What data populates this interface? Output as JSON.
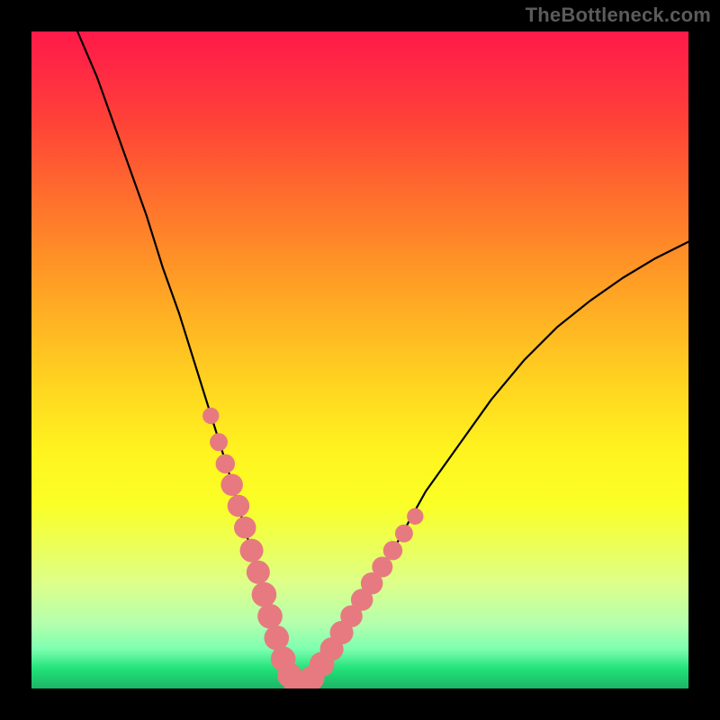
{
  "watermark": "TheBottleneck.com",
  "chart_data": {
    "type": "line",
    "title": "",
    "xlabel": "",
    "ylabel": "",
    "xlim": [
      0,
      100
    ],
    "ylim": [
      0,
      100
    ],
    "series": [
      {
        "name": "curve",
        "x": [
          7,
          10,
          12.5,
          15,
          17.5,
          20,
          22.5,
          25,
          27.5,
          30,
          32,
          34,
          35.5,
          37,
          38,
          39,
          40,
          41,
          43,
          46,
          50,
          55,
          60,
          65,
          70,
          75,
          80,
          85,
          90,
          95,
          100
        ],
        "y": [
          100,
          93,
          86,
          79,
          72,
          64,
          57,
          49,
          41,
          33,
          26,
          19,
          13,
          8,
          5,
          2,
          0.5,
          0.5,
          2,
          6,
          12,
          21,
          30,
          37,
          44,
          50,
          55,
          59,
          62.5,
          65.5,
          68
        ]
      }
    ],
    "markers": {
      "name": "left-dots",
      "color": "#e77a80",
      "points": [
        {
          "x": 27.3,
          "y": 41.5,
          "r": 1.2
        },
        {
          "x": 28.5,
          "y": 37.5,
          "r": 1.3
        },
        {
          "x": 29.5,
          "y": 34.2,
          "r": 1.4
        },
        {
          "x": 30.5,
          "y": 31.0,
          "r": 1.6
        },
        {
          "x": 31.5,
          "y": 27.8,
          "r": 1.6
        },
        {
          "x": 32.5,
          "y": 24.5,
          "r": 1.6
        },
        {
          "x": 33.5,
          "y": 21.0,
          "r": 1.7
        },
        {
          "x": 34.5,
          "y": 17.7,
          "r": 1.7
        },
        {
          "x": 35.4,
          "y": 14.3,
          "r": 1.8
        },
        {
          "x": 36.3,
          "y": 11.0,
          "r": 1.8
        },
        {
          "x": 37.3,
          "y": 7.7,
          "r": 1.8
        },
        {
          "x": 38.3,
          "y": 4.5,
          "r": 1.8
        },
        {
          "x": 39.3,
          "y": 2.0,
          "r": 1.8
        },
        {
          "x": 40.3,
          "y": 0.7,
          "r": 1.8
        },
        {
          "x": 41.5,
          "y": 0.6,
          "r": 1.8
        },
        {
          "x": 42.7,
          "y": 1.6,
          "r": 1.8
        },
        {
          "x": 44.2,
          "y": 3.7,
          "r": 1.8
        },
        {
          "x": 45.7,
          "y": 6.0,
          "r": 1.7
        },
        {
          "x": 47.2,
          "y": 8.5,
          "r": 1.7
        },
        {
          "x": 48.7,
          "y": 11.0,
          "r": 1.6
        },
        {
          "x": 50.3,
          "y": 13.5,
          "r": 1.6
        },
        {
          "x": 51.8,
          "y": 16.0,
          "r": 1.6
        },
        {
          "x": 53.4,
          "y": 18.5,
          "r": 1.5
        },
        {
          "x": 55.0,
          "y": 21.0,
          "r": 1.4
        },
        {
          "x": 56.7,
          "y": 23.6,
          "r": 1.3
        },
        {
          "x": 58.4,
          "y": 26.2,
          "r": 1.2
        }
      ]
    },
    "gradient_stops": [
      {
        "pos": 0,
        "color": "#ff1a49"
      },
      {
        "pos": 24,
        "color": "#ff6a2e"
      },
      {
        "pos": 54,
        "color": "#ffd520"
      },
      {
        "pos": 78,
        "color": "#ecff56"
      },
      {
        "pos": 97,
        "color": "#21e27a"
      },
      {
        "pos": 100,
        "color": "#1db466"
      }
    ]
  }
}
